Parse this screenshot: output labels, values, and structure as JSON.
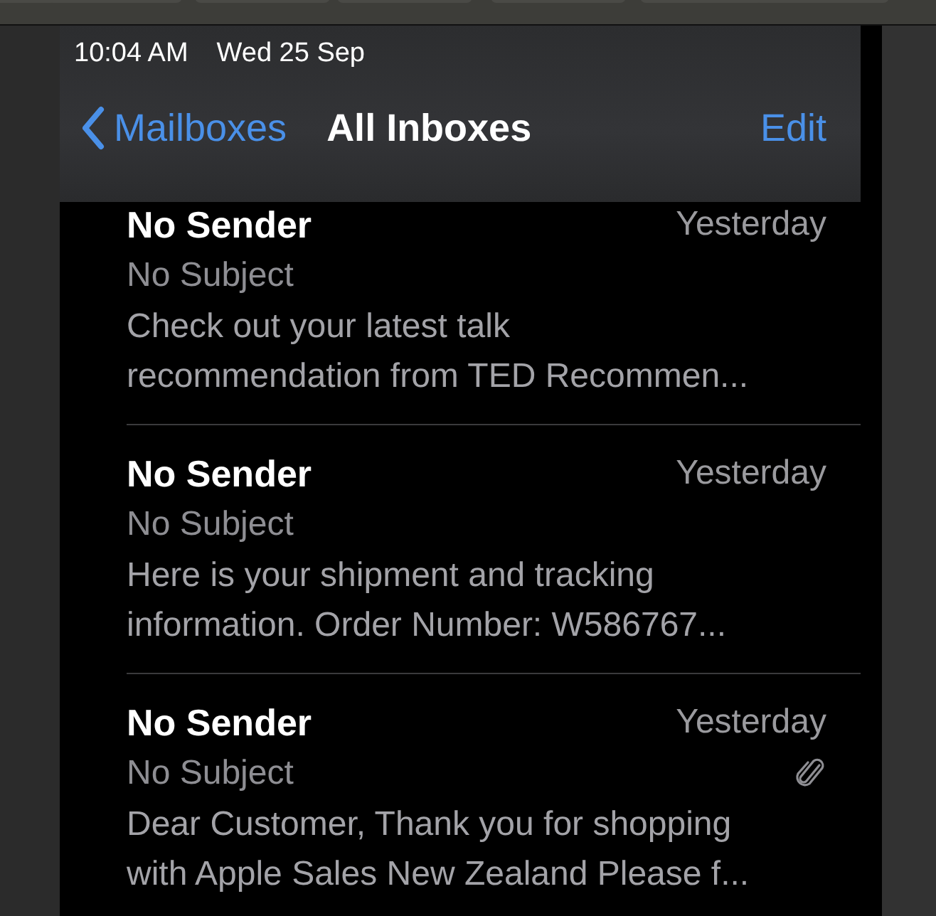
{
  "status_bar": {
    "time": "10:04 AM",
    "date": "Wed 25 Sep"
  },
  "nav": {
    "back": "Mailboxes",
    "title": "All Inboxes",
    "action": "Edit"
  },
  "messages": [
    {
      "sender": "No Sender",
      "date": "Yesterday",
      "subject": "No Subject",
      "preview": [
        "Check out your latest talk",
        "recommendation from TED Recommen..."
      ],
      "attachment": false
    },
    {
      "sender": "No Sender",
      "date": "Yesterday",
      "subject": "No Subject",
      "preview": [
        "Here is your shipment and tracking",
        "information. Order Number: W586767..."
      ],
      "attachment": false
    },
    {
      "sender": "No Sender",
      "date": "Yesterday",
      "subject": "No Subject",
      "preview": [
        "Dear Customer, Thank you for shopping",
        "with Apple Sales New Zealand Please f..."
      ],
      "attachment": true
    }
  ]
}
